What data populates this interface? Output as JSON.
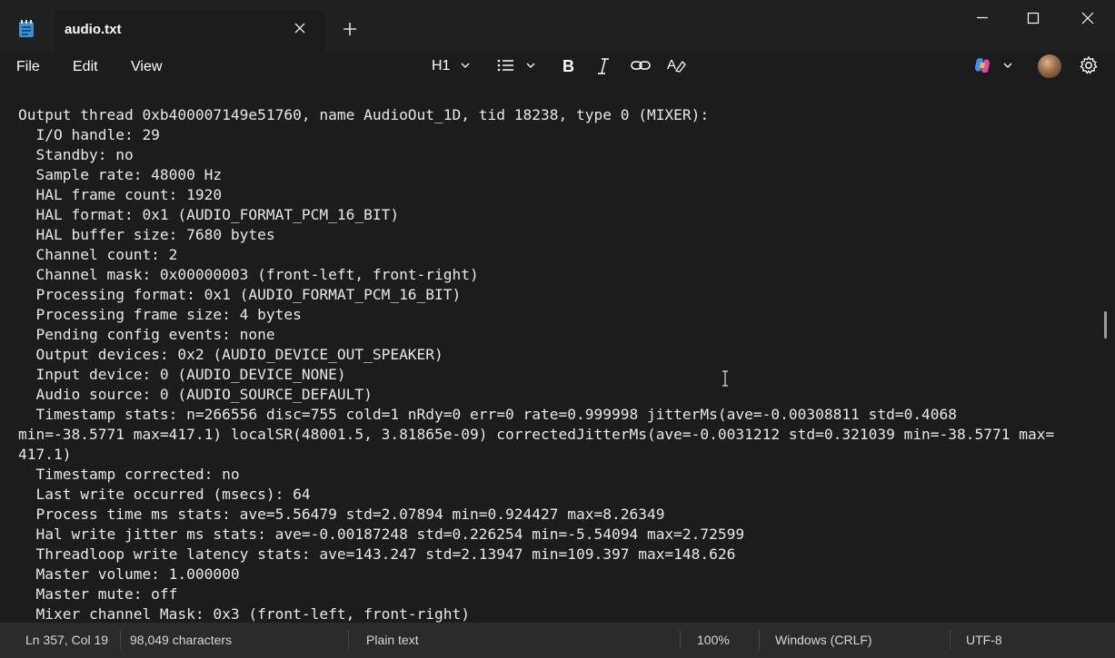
{
  "tab": {
    "title": "audio.txt"
  },
  "menu": {
    "file": "File",
    "edit": "Edit",
    "view": "View"
  },
  "toolbar": {
    "heading": "H1"
  },
  "editor": {
    "lines": [
      "Output thread 0xb400007149e51760, name AudioOut_1D, tid 18238, type 0 (MIXER):",
      "  I/O handle: 29",
      "  Standby: no",
      "  Sample rate: 48000 Hz",
      "  HAL frame count: 1920",
      "  HAL format: 0x1 (AUDIO_FORMAT_PCM_16_BIT)",
      "  HAL buffer size: 7680 bytes",
      "  Channel count: 2",
      "  Channel mask: 0x00000003 (front-left, front-right)",
      "  Processing format: 0x1 (AUDIO_FORMAT_PCM_16_BIT)",
      "  Processing frame size: 4 bytes",
      "  Pending config events: none",
      "  Output devices: 0x2 (AUDIO_DEVICE_OUT_SPEAKER)",
      "  Input device: 0 (AUDIO_DEVICE_NONE)",
      "  Audio source: 0 (AUDIO_SOURCE_DEFAULT)",
      "  Timestamp stats: n=266556 disc=755 cold=1 nRdy=0 err=0 rate=0.999998 jitterMs(ave=-0.00308811 std=0.4068",
      "min=-38.5771 max=417.1) localSR(48001.5, 3.81865e-09) correctedJitterMs(ave=-0.0031212 std=0.321039 min=-38.5771 max=",
      "417.1)",
      "  Timestamp corrected: no",
      "  Last write occurred (msecs): 64",
      "  Process time ms stats: ave=5.56479 std=2.07894 min=0.924427 max=8.26349",
      "  Hal write jitter ms stats: ave=-0.00187248 std=0.226254 min=-5.54094 max=2.72599",
      "  Threadloop write latency stats: ave=143.247 std=2.13947 min=109.397 max=148.626",
      "  Master volume: 1.000000",
      "  Master mute: off",
      "  Mixer channel Mask: 0x3 (front-left, front-right)"
    ]
  },
  "status": {
    "position": "Ln 357, Col 19",
    "characters": "98,049 characters",
    "format": "Plain text",
    "zoom": "100%",
    "line_ending": "Windows (CRLF)",
    "encoding": "UTF-8"
  }
}
